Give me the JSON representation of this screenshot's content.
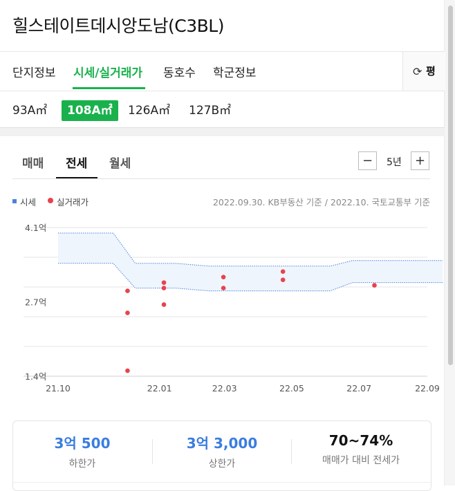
{
  "title": "힐스테이트데시앙도남(C3BL)",
  "main_tabs": [
    {
      "label": "단지정보"
    },
    {
      "label": "시세/실거래가"
    },
    {
      "label": "동호수"
    },
    {
      "label": "학군정보"
    }
  ],
  "refresh": {
    "label": "평",
    "icon": "refresh-icon"
  },
  "size_tabs": [
    {
      "label": "93A㎡"
    },
    {
      "label": "108A㎡"
    },
    {
      "label": "126A㎡"
    },
    {
      "label": "127B㎡"
    }
  ],
  "deal_tabs": [
    {
      "label": "매매"
    },
    {
      "label": "전세"
    },
    {
      "label": "월세"
    }
  ],
  "period": {
    "minus": "−",
    "value": "5년",
    "plus": "+"
  },
  "legend": {
    "price_label": "시세",
    "deal_label": "실거래가",
    "source": "2022.09.30. KB부동산 기준 / 2022.10. 국토교통부 기준"
  },
  "chart_data": {
    "type": "line",
    "title": "",
    "xlabel": "",
    "ylabel": "",
    "x_ticks": [
      "21.10",
      "22.01",
      "22.03",
      "22.05",
      "22.07",
      "22.09"
    ],
    "y_ticks": [
      "4.1억",
      "2.7억",
      "1.4억"
    ],
    "ylim": [
      1.4,
      4.1
    ],
    "xlim_months": [
      "2021-10",
      "2022-09"
    ],
    "band_x": [
      "2021-10",
      "2021-11-20",
      "2021-12-10",
      "2022-01-15",
      "2022-02-15",
      "2022-06-05",
      "2022-06-25",
      "2022-09-15"
    ],
    "band_upper": [
      4.0,
      4.0,
      3.45,
      3.45,
      3.4,
      3.4,
      3.5,
      3.5
    ],
    "band_lower": [
      3.45,
      3.45,
      3.0,
      3.0,
      2.95,
      2.95,
      3.1,
      3.1
    ],
    "series": [
      {
        "name": "실거래가",
        "points": [
          {
            "x": "2021-12-03",
            "y": 2.95
          },
          {
            "x": "2021-12-03",
            "y": 2.55
          },
          {
            "x": "2021-12-03",
            "y": 1.5
          },
          {
            "x": "2022-01-05",
            "y": 3.1
          },
          {
            "x": "2022-01-05",
            "y": 3.0
          },
          {
            "x": "2022-01-05",
            "y": 2.7
          },
          {
            "x": "2022-02-28",
            "y": 3.2
          },
          {
            "x": "2022-02-28",
            "y": 3.0
          },
          {
            "x": "2022-04-23",
            "y": 3.3
          },
          {
            "x": "2022-04-23",
            "y": 3.15
          },
          {
            "x": "2022-07-15",
            "y": 3.05
          }
        ]
      }
    ],
    "colors": {
      "band_fill": "#eef5fd",
      "band_line": "#4a82dc",
      "point": "#e8434d",
      "grid": "#e6e6e6"
    }
  },
  "summary": [
    {
      "value": "3억 500",
      "label": "하한가"
    },
    {
      "value": "3억 3,000",
      "label": "상한가"
    },
    {
      "value": "70~74%",
      "label": "매매가 대비 전세가"
    }
  ],
  "accent": "#19b14c"
}
